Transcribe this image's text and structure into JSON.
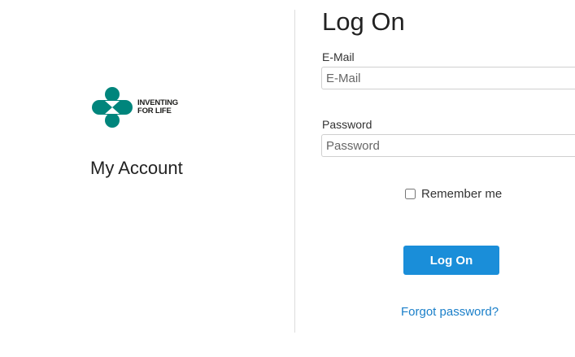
{
  "brand": {
    "logo_icon": "merck-hourglass-logo-icon",
    "logo_line1": "INVENTING",
    "logo_line2": "FOR LIFE",
    "logo_color": "#00857c"
  },
  "left": {
    "title": "My Account"
  },
  "form": {
    "title": "Log On",
    "email": {
      "label": "E-Mail",
      "placeholder": "E-Mail",
      "value": ""
    },
    "password": {
      "label": "Password",
      "placeholder": "Password",
      "value": ""
    },
    "remember_label": "Remember me",
    "remember_checked": false,
    "submit_label": "Log On",
    "forgot_label": "Forgot password?"
  },
  "colors": {
    "primary_button": "#1a8ed9",
    "link": "#1a7fc9",
    "divider": "#dddddd"
  }
}
